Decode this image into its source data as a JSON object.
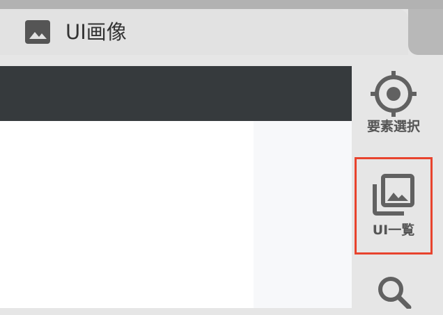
{
  "tab": {
    "title": "UI画像",
    "icon": "image-icon"
  },
  "sidebar": {
    "items": [
      {
        "label": "要素選択",
        "icon": "target-icon",
        "selected": false
      },
      {
        "label": "UI一覧",
        "icon": "image-library-icon",
        "selected": true
      },
      {
        "label": "",
        "icon": "search-icon",
        "selected": false
      }
    ]
  },
  "colors": {
    "highlight_border": "#e8432d",
    "header_dark": "#363a3d",
    "icon_gray": "#616161"
  }
}
